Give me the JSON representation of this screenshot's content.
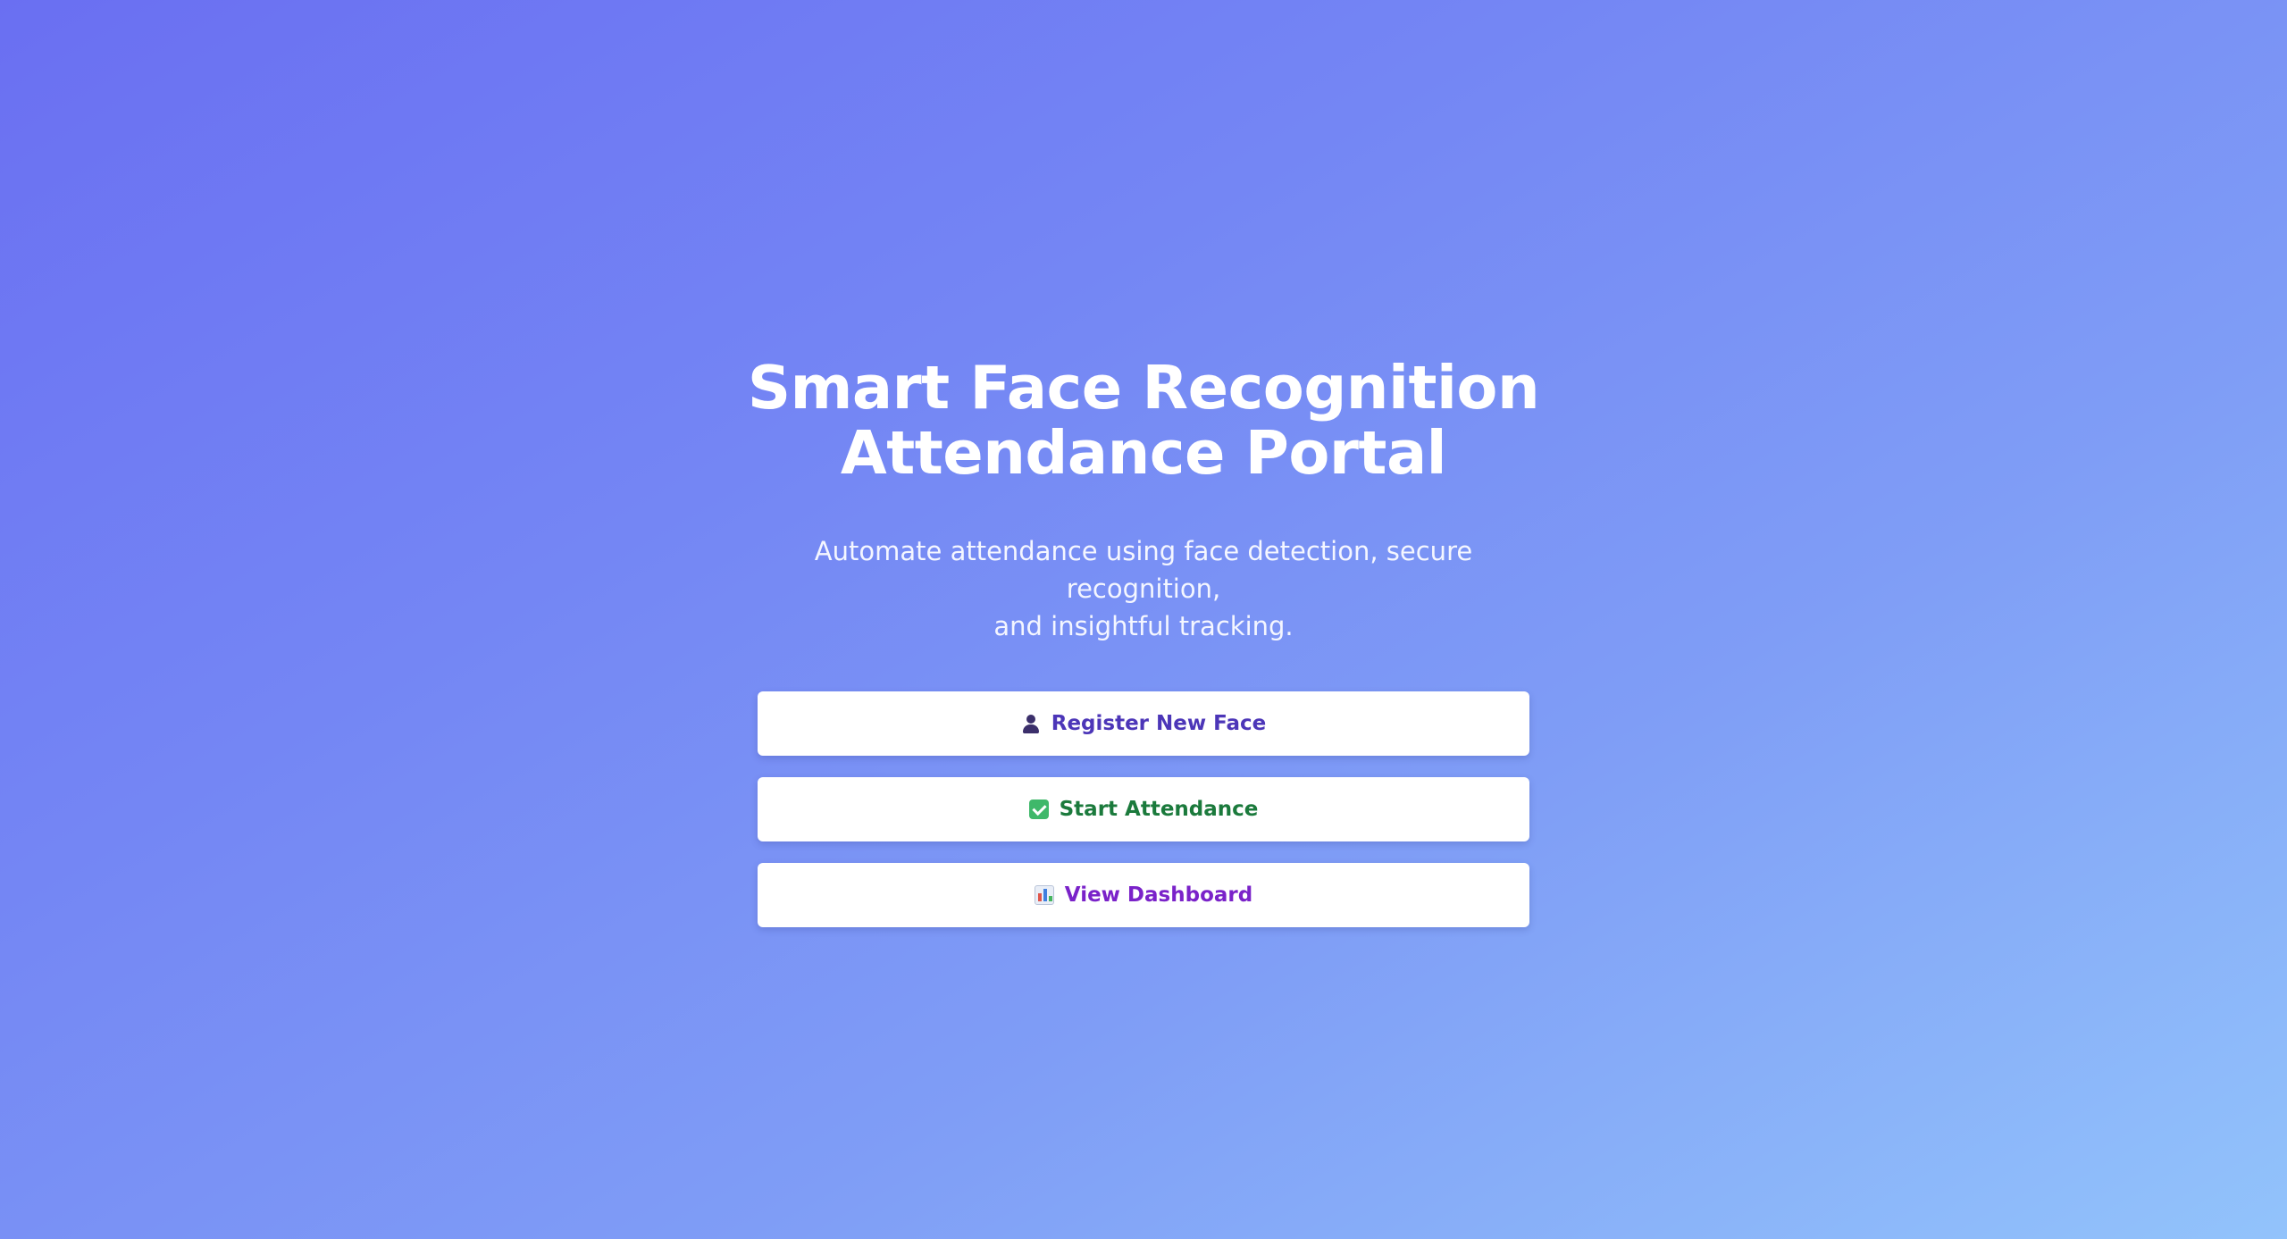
{
  "hero": {
    "title_line1": "Smart Face Recognition",
    "title_line2": "Attendance Portal",
    "subtitle_line1": "Automate attendance using face detection, secure recognition,",
    "subtitle_line2": "and insightful tracking."
  },
  "actions": [
    {
      "label": "Register New Face",
      "icon": "person-icon",
      "color": "#4c36b8"
    },
    {
      "label": "Start Attendance",
      "icon": "check-icon",
      "color": "#1b7a3c"
    },
    {
      "label": "View Dashboard",
      "icon": "bar-chart-icon",
      "color": "#7a22c9"
    }
  ],
  "theme": {
    "gradient_start": "#6a6ff2",
    "gradient_end": "#92c3fb",
    "button_background": "#ffffff"
  }
}
